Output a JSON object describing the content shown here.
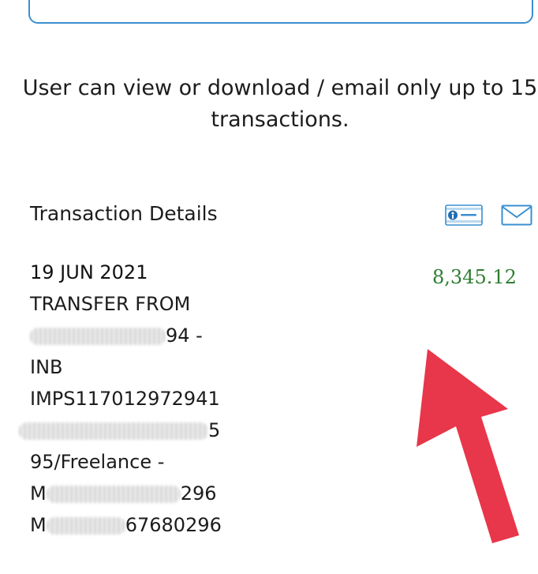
{
  "notice": {
    "line1": "User can view or download / email only up to 15",
    "line2": "transactions."
  },
  "section": {
    "title": "Transaction Details"
  },
  "icons": {
    "statement": "statement-card-icon",
    "mail": "mail-icon",
    "arrow": "arrow-pointer-icon"
  },
  "transaction": {
    "date": "19 JUN 2021",
    "line1": "TRANSFER FROM",
    "line2_tail": "94 -",
    "line3": "INB",
    "line4": "IMPS117012972941",
    "line5_tail": "5",
    "line6": "95/Freelance -",
    "line7_head": "M",
    "line7_tail": "296",
    "line8_head": "M",
    "line8_tail": "67680296",
    "amount": "8,345.12"
  },
  "colors": {
    "accent": "#3a8fd0",
    "amount": "#2e7d32",
    "arrow": "#e8364a"
  }
}
